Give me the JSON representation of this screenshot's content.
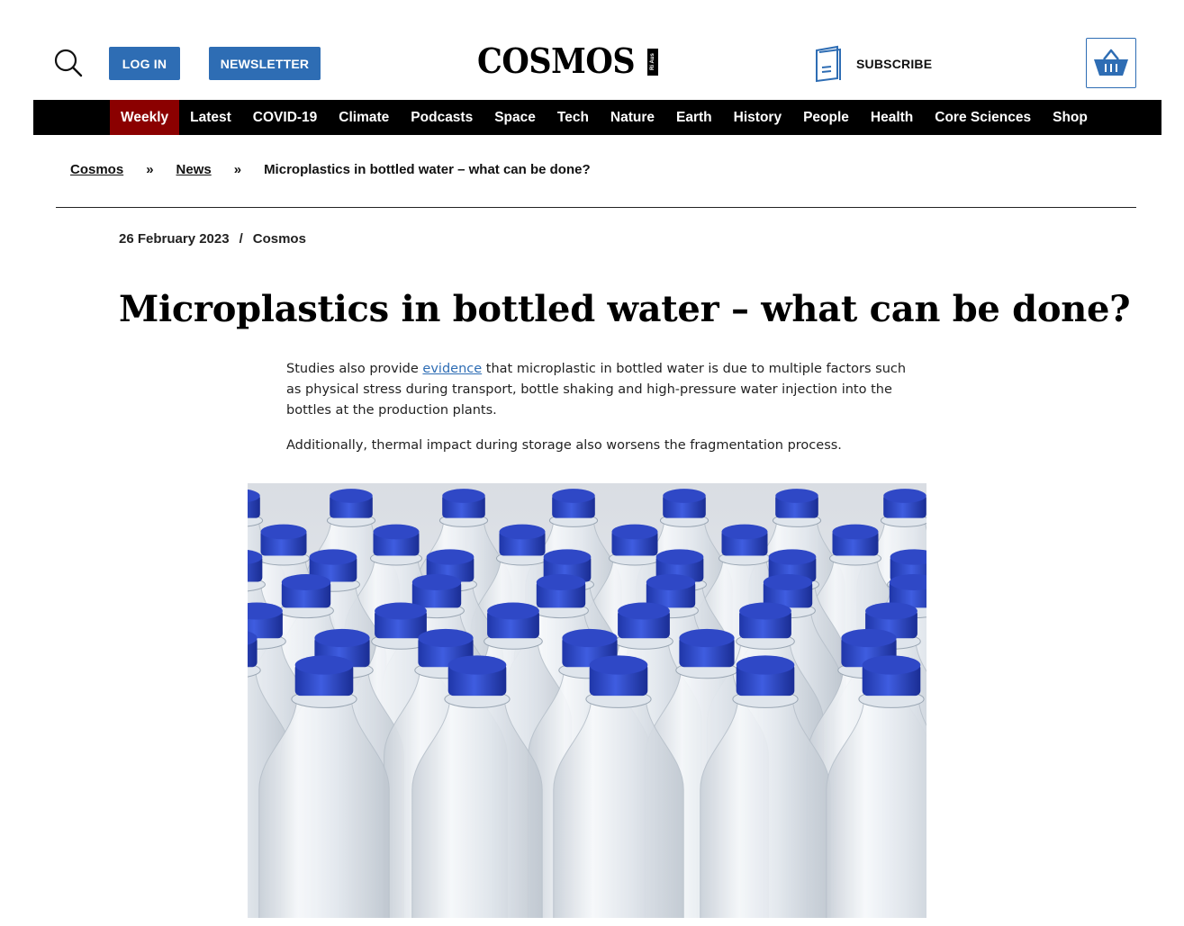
{
  "header": {
    "login_label": "LOG IN",
    "newsletter_label": "NEWSLETTER",
    "logo_text": "COSMOS",
    "logo_badge": "Ri Aus",
    "subscribe_label": "SUBSCRIBE",
    "accent_color": "#2e6db4"
  },
  "nav": {
    "items": [
      {
        "label": "Weekly"
      },
      {
        "label": "Latest"
      },
      {
        "label": "COVID-19"
      },
      {
        "label": "Climate"
      },
      {
        "label": "Podcasts"
      },
      {
        "label": "Space"
      },
      {
        "label": "Tech"
      },
      {
        "label": "Nature"
      },
      {
        "label": "Earth"
      },
      {
        "label": "History"
      },
      {
        "label": "People"
      },
      {
        "label": "Health"
      },
      {
        "label": "Core Sciences"
      },
      {
        "label": "Shop"
      }
    ],
    "active_color": "#8b0000"
  },
  "breadcrumb": {
    "home": "Cosmos",
    "section": "News",
    "current": "Microplastics in bottled water – what can be done?",
    "separator": "»"
  },
  "article": {
    "date": "26 February 2023",
    "meta_separator": "/",
    "author": "Cosmos",
    "title": "Microplastics in bottled water – what can be done?",
    "p1_before": "Studies also provide ",
    "p1_link": "evidence",
    "p1_after": " that microplastic in bottled water is due to multiple factors such as physical stress during transport, bottle shaking and high-pressure water injection into the bottles at the production plants.",
    "p2": "Additionally, thermal impact during storage also worsens the fragmentation process."
  }
}
